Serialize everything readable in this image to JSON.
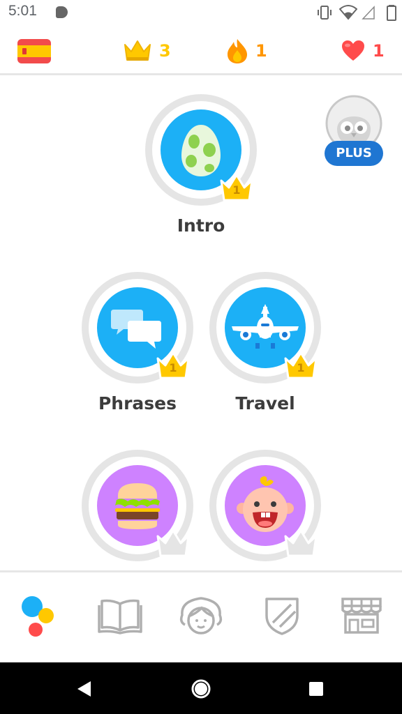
{
  "status_bar": {
    "time": "5:01"
  },
  "top_bar": {
    "course_flag": "spain-flag-icon",
    "crowns": {
      "icon": "crown-icon",
      "count": "3",
      "color": "#ffc800"
    },
    "streak": {
      "icon": "flame-icon",
      "count": "1",
      "color": "#ff9600"
    },
    "hearts": {
      "icon": "heart-icon",
      "count": "1",
      "color": "#ff4b4b"
    }
  },
  "plus_badge": {
    "label": "PLUS"
  },
  "skills": [
    {
      "label": "Intro",
      "icon": "egg-icon",
      "crown_level": "1",
      "unlocked": true,
      "color": "#1cb0f6"
    },
    {
      "label": "Phrases",
      "icon": "speech-bubbles-icon",
      "crown_level": "1",
      "unlocked": true,
      "color": "#1cb0f6"
    },
    {
      "label": "Travel",
      "icon": "airplane-icon",
      "crown_level": "1",
      "unlocked": true,
      "color": "#1cb0f6"
    },
    {
      "label": "",
      "icon": "burger-icon",
      "crown_level": "",
      "unlocked": false,
      "color": "#ce82ff"
    },
    {
      "label": "",
      "icon": "baby-icon",
      "crown_level": "",
      "unlocked": false,
      "color": "#ce82ff"
    }
  ],
  "bottom_nav": [
    {
      "icon": "learn-dots-icon",
      "active": true
    },
    {
      "icon": "stories-book-icon",
      "active": false
    },
    {
      "icon": "profile-face-icon",
      "active": false
    },
    {
      "icon": "leaderboard-shield-icon",
      "active": false
    },
    {
      "icon": "shop-icon",
      "active": false
    }
  ]
}
